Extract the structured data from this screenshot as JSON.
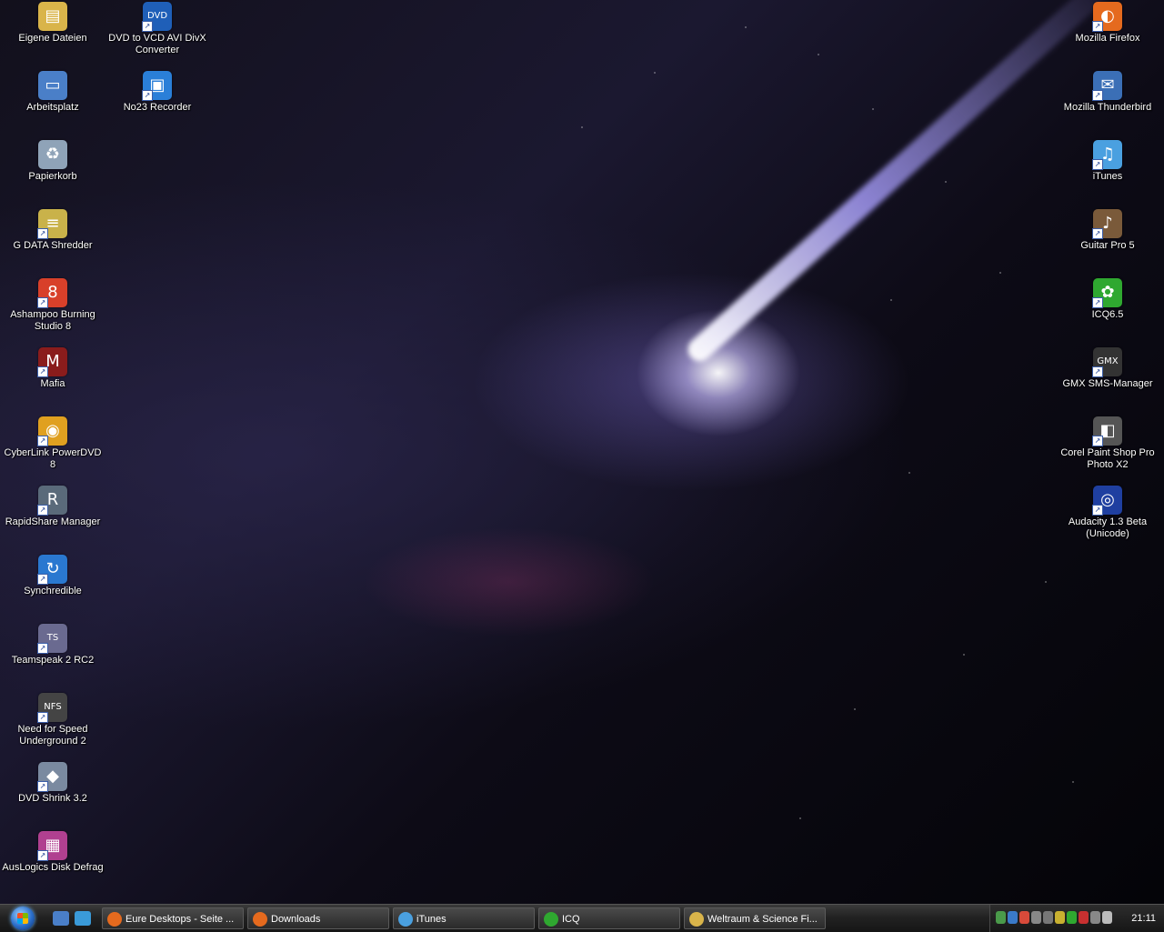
{
  "desktop": {
    "left_icons": [
      {
        "label": "Eigene Dateien",
        "icon": "my-documents-folder-icon",
        "color": "#d9b44a",
        "sym": "▤",
        "shortcut": false
      },
      {
        "label": "Arbeitsplatz",
        "icon": "my-computer-icon",
        "color": "#4a7fc8",
        "sym": "▭",
        "shortcut": false
      },
      {
        "label": "Papierkorb",
        "icon": "recycle-bin-icon",
        "color": "#8fa3b8",
        "sym": "♻",
        "shortcut": false
      },
      {
        "label": "G DATA Shredder",
        "icon": "shredder-icon",
        "color": "#c9b24a",
        "sym": "≡",
        "shortcut": true
      },
      {
        "label": "Ashampoo Burning Studio 8",
        "icon": "burning-studio-icon",
        "color": "#d8402a",
        "sym": "8",
        "shortcut": true
      },
      {
        "label": "Mafia",
        "icon": "mafia-game-icon",
        "color": "#8a1c1c",
        "sym": "M",
        "shortcut": true
      },
      {
        "label": "CyberLink PowerDVD 8",
        "icon": "powerdvd-icon",
        "color": "#e0a020",
        "sym": "◉",
        "shortcut": true
      },
      {
        "label": "RapidShare Manager",
        "icon": "rapidshare-icon",
        "color": "#5a6a7a",
        "sym": "R",
        "shortcut": true
      },
      {
        "label": "Synchredible",
        "icon": "sync-icon",
        "color": "#2a78d0",
        "sym": "↻",
        "shortcut": true
      },
      {
        "label": "Teamspeak 2 RC2",
        "icon": "teamspeak-icon",
        "color": "#6a6a90",
        "sym": "TS",
        "shortcut": true
      },
      {
        "label": "Need for Speed Underground 2",
        "icon": "nfs-game-icon",
        "color": "#444",
        "sym": "NFS",
        "shortcut": true
      },
      {
        "label": "DVD Shrink 3.2",
        "icon": "dvd-shrink-icon",
        "color": "#7a8aa0",
        "sym": "◆",
        "shortcut": true
      },
      {
        "label": "AusLogics Disk Defrag",
        "icon": "disk-defrag-icon",
        "color": "#b04090",
        "sym": "▦",
        "shortcut": true
      }
    ],
    "second_column_icons": [
      {
        "label": "DVD to VCD AVI DivX Converter",
        "icon": "dvd-converter-icon",
        "color": "#1f5fb8",
        "sym": "DVD",
        "shortcut": true
      },
      {
        "label": "No23 Recorder",
        "icon": "no23-recorder-icon",
        "color": "#2a7fd8",
        "sym": "▣",
        "shortcut": true
      }
    ],
    "right_icons": [
      {
        "label": "Mozilla Firefox",
        "icon": "firefox-icon",
        "color": "#e56a1e",
        "sym": "◐",
        "shortcut": true
      },
      {
        "label": "Mozilla Thunderbird",
        "icon": "thunderbird-icon",
        "color": "#3b6fb6",
        "sym": "✉",
        "shortcut": true
      },
      {
        "label": "iTunes",
        "icon": "itunes-icon",
        "color": "#4aa0e0",
        "sym": "♫",
        "shortcut": true
      },
      {
        "label": "Guitar Pro 5",
        "icon": "guitar-pro-icon",
        "color": "#7a5a3a",
        "sym": "♪",
        "shortcut": true
      },
      {
        "label": "ICQ6.5",
        "icon": "icq-flower-icon",
        "color": "#2fa830",
        "sym": "✿",
        "shortcut": true
      },
      {
        "label": "GMX SMS-Manager",
        "icon": "gmx-sms-icon",
        "color": "#333",
        "sym": "GMX",
        "shortcut": true
      },
      {
        "label": "Corel Paint Shop Pro Photo X2",
        "icon": "paint-shop-pro-icon",
        "color": "#555",
        "sym": "◧",
        "shortcut": true
      },
      {
        "label": "Audacity 1.3 Beta (Unicode)",
        "icon": "audacity-icon",
        "color": "#1f3fa0",
        "sym": "◎",
        "shortcut": true
      }
    ]
  },
  "taskbar": {
    "start_icon": "windows-start-orb-icon",
    "quick_launch": [
      {
        "icon": "show-desktop-icon",
        "color": "#4a7fc8"
      },
      {
        "icon": "firefox-quicklaunch-icon",
        "color": "#3a9ad8"
      }
    ],
    "tasks": [
      {
        "label": "Eure Desktops - Seite ...",
        "icon": "firefox-icon",
        "color": "#e56a1e"
      },
      {
        "label": "Downloads",
        "icon": "firefox-downloads-icon",
        "color": "#e56a1e"
      },
      {
        "label": "iTunes",
        "icon": "itunes-icon",
        "color": "#4aa0e0"
      },
      {
        "label": "ICQ",
        "icon": "icq-flower-icon",
        "color": "#2fa830"
      },
      {
        "label": "Weltraum & Science Fi...",
        "icon": "folder-icon",
        "color": "#d9b44a"
      }
    ],
    "tray_icons": [
      {
        "icon": "tray-shield-icon",
        "color": "#4a9a4a"
      },
      {
        "icon": "tray-network-icon",
        "color": "#3a7ac8"
      },
      {
        "icon": "tray-firefox-icon",
        "color": "#d84a3a"
      },
      {
        "icon": "tray-printer-icon",
        "color": "#888"
      },
      {
        "icon": "tray-drive-icon",
        "color": "#777"
      },
      {
        "icon": "tray-status-icon",
        "color": "#c8b030"
      },
      {
        "icon": "tray-signal-icon",
        "color": "#2fa830"
      },
      {
        "icon": "tray-antivirus-icon",
        "color": "#c83030"
      },
      {
        "icon": "tray-safely-remove-icon",
        "color": "#888"
      },
      {
        "icon": "tray-volume-icon",
        "color": "#bbb"
      }
    ],
    "clock": "21:11"
  }
}
